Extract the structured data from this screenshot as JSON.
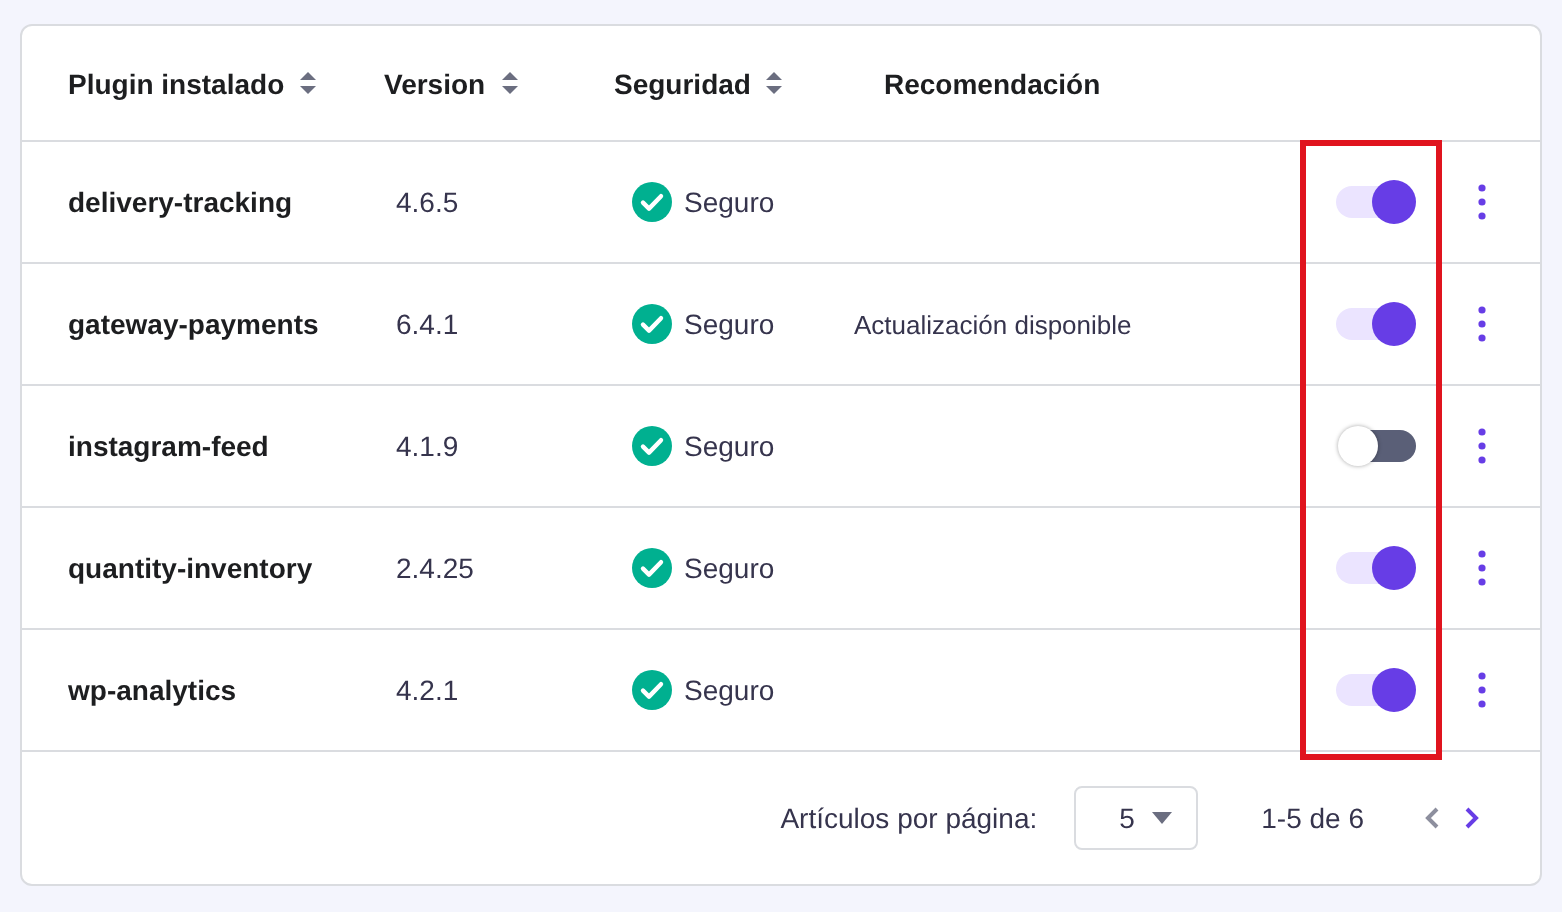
{
  "table": {
    "columns": [
      {
        "label": "Plugin instalado",
        "sortable": true
      },
      {
        "label": "Version",
        "sortable": true
      },
      {
        "label": "Seguridad",
        "sortable": true
      },
      {
        "label": "Recomendación",
        "sortable": false
      }
    ],
    "rows": [
      {
        "plugin": "delivery-tracking",
        "version": "4.6.5",
        "security": "Seguro",
        "recommendation": "",
        "on": true
      },
      {
        "plugin": "gateway-payments",
        "version": "6.4.1",
        "security": "Seguro",
        "recommendation": "Actualización disponible",
        "on": true
      },
      {
        "plugin": "instagram-feed",
        "version": "4.1.9",
        "security": "Seguro",
        "recommendation": "",
        "on": false
      },
      {
        "plugin": "quantity-inventory",
        "version": "2.4.25",
        "security": "Seguro",
        "recommendation": "",
        "on": true
      },
      {
        "plugin": "wp-analytics",
        "version": "4.2.1",
        "security": "Seguro",
        "recommendation": "",
        "on": true
      }
    ]
  },
  "pagination": {
    "per_page_label": "Artículos por página:",
    "per_page": "5",
    "range": "1-5 de 6",
    "prev_disabled": true,
    "next_disabled": false
  }
}
